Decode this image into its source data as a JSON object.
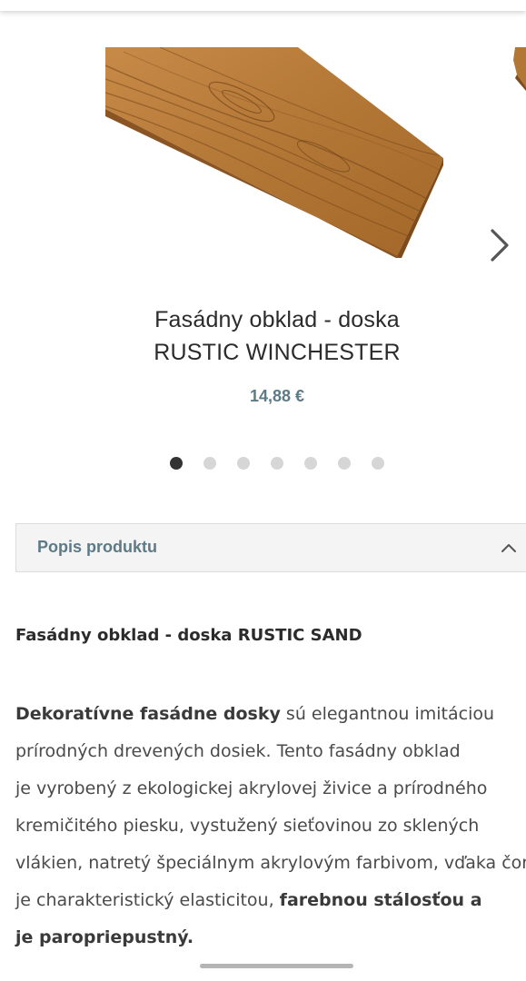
{
  "product": {
    "title_line1": "Fasádny obklad - doska",
    "title_line2": "RUSTIC WINCHESTER",
    "price": "14,88 €"
  },
  "carousel": {
    "slide_count": 7,
    "active_index": 0
  },
  "icons": {
    "next": "chevron-right-icon",
    "accordion": "chevron-up-icon"
  },
  "accordion": {
    "title": "Popis produktu",
    "expanded": true
  },
  "description": {
    "heading": "Fasádny obklad - doska RUSTIC SAND",
    "lines": [
      {
        "bold_start": "Dekoratívne fasádne dosky",
        "text": " sú elegantnou imitáciou",
        "bold_end": ""
      },
      {
        "bold_start": "",
        "text": "prírodných drevených dosiek. Tento fasádny obklad",
        "bold_end": ""
      },
      {
        "bold_start": "",
        "text": "je vyrobený z ekologickej akrylovej živice a prírodného",
        "bold_end": ""
      },
      {
        "bold_start": "",
        "text": "kremičitého piesku, vystužený sieťovinou zo sklených",
        "bold_end": ""
      },
      {
        "bold_start": "",
        "text": "vlákien, natretý špeciálnym akrylovým farbivom, vďaka čom",
        "bold_end": ""
      },
      {
        "bold_start": "",
        "text": "je charakteristický elasticitou, ",
        "bold_end": "farebnou stálosťou a"
      },
      {
        "bold_start": "je paropriepustný.",
        "text": "",
        "bold_end": ""
      }
    ]
  },
  "colors": {
    "accent": "#5d7a86",
    "accordion_bg": "#f4f4f4",
    "dot_active": "#333333",
    "dot_inactive": "#d6d6d6"
  }
}
